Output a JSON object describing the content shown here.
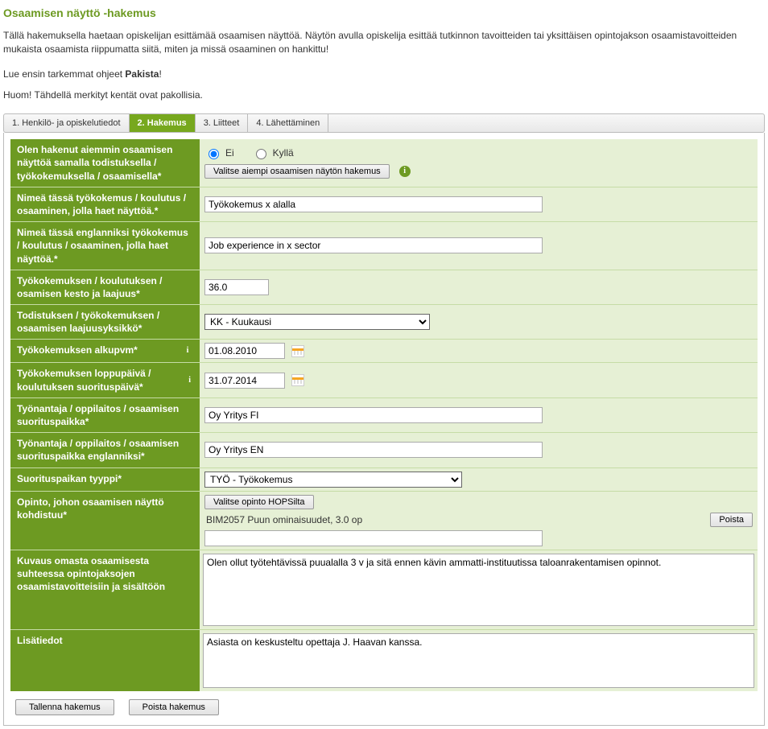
{
  "page_title": "Osaamisen näyttö -hakemus",
  "intro": {
    "p1": "Tällä hakemuksella haetaan opiskelijan esittämää osaamisen näyttöä. Näytön avulla opiskelija esittää tutkinnon tavoitteiden tai yksittäisen opintojakson osaamistavoitteiden mukaista osaamista riippumatta siitä, miten ja missä osaaminen on hankittu!",
    "p2_before": "Lue ensin tarkemmat ohjeet ",
    "p2_bold": "Pakista",
    "p2_after": "!",
    "p3": "Huom! Tähdellä merkityt kentät ovat pakollisia."
  },
  "tabs": [
    {
      "label": "1. Henkilö- ja opiskelutiedot",
      "active": false
    },
    {
      "label": "2. Hakemus",
      "active": true
    },
    {
      "label": "3. Liitteet",
      "active": false
    },
    {
      "label": "4. Lähettäminen",
      "active": false
    }
  ],
  "labels": {
    "prev_app": "Olen hakenut aiemmin osaamisen näyttöä samalla todistuksella / työkokemuksella / osaamisella*",
    "name_fi": "Nimeä tässä työkokemus / koulutus / osaaminen, jolla haet näyttöä.*",
    "name_en": "Nimeä tässä englanniksi työkokemus / koulutus / osaaminen, jolla haet näyttöä.*",
    "duration": "Työkokemuksen / koulutuksen / osamisen kesto ja laajuus*",
    "unit": "Todistuksen / työkokemuksen / osaamisen laajuusyksikkö*",
    "start": "Työkokemuksen alkupvm*",
    "end": "Työkokemuksen loppupäivä / koulutuksen suorituspäivä*",
    "employer_fi": "Työnantaja / oppilaitos / osaamisen suorituspaikka*",
    "employer_en": "Työnantaja / oppilaitos / osaamisen suorituspaikka englanniksi*",
    "place_type": "Suorituspaikan tyyppi*",
    "study": "Opinto, johon osaamisen näyttö kohdistuu*",
    "desc": "Kuvaus omasta osaamisesta suhteessa opintojaksojen osaamistavoitteisiin ja sisältöön",
    "extra": "Lisätiedot"
  },
  "radio": {
    "no": "Ei",
    "yes": "Kyllä",
    "selected": "no"
  },
  "buttons": {
    "pick_prev": "Valitse aiempi osaamisen näytön  hakemus",
    "pick_study": "Valitse opinto HOPSilta",
    "remove": "Poista",
    "save": "Tallenna hakemus",
    "delete": "Poista hakemus"
  },
  "values": {
    "name_fi": "Työkokemus x alalla",
    "name_en": "Job experience in x sector",
    "duration": "36.0",
    "unit": "KK - Kuukausi",
    "start": "01.08.2010",
    "end": "31.07.2014",
    "employer_fi": "Oy Yritys FI",
    "employer_en": "Oy Yritys EN",
    "place_type": "TYÖ - Työkokemus",
    "study_item": "BIM2057 Puun ominaisuudet, 3.0 op",
    "study_input": "",
    "desc": "Olen ollut työtehtävissä puualalla 3 v ja sitä ennen kävin ammatti-instituutissa taloanrakentamisen opinnot.",
    "extra": "Asiasta on keskusteltu opettaja J. Haavan kanssa."
  }
}
